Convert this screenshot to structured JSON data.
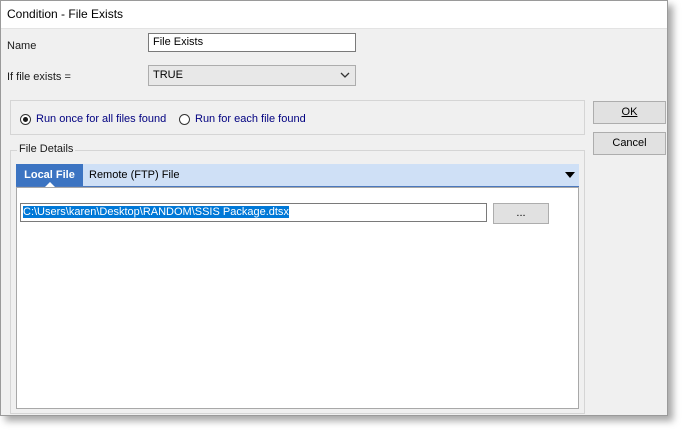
{
  "window": {
    "title": "Condition - File Exists"
  },
  "form": {
    "name_label": "Name",
    "name_value": "File Exists",
    "if_exists_label": "If file exists =",
    "if_exists_value": "TRUE"
  },
  "run_mode": {
    "option_once": "Run once for all files found",
    "option_each": "Run for each file found",
    "selected": "once"
  },
  "buttons": {
    "ok": "OK",
    "cancel": "Cancel"
  },
  "file_details": {
    "legend": "File Details",
    "tabs": [
      {
        "label": "Local File",
        "active": true
      },
      {
        "label": "Remote (FTP) File",
        "active": false
      }
    ],
    "path_value": "C:\\Users\\karen\\Desktop\\RANDOM\\SSIS Package.dtsx",
    "browse_label": "..."
  },
  "icons": {
    "combo": "chevron-down-icon",
    "tab_menu": "triangle-down-icon"
  }
}
